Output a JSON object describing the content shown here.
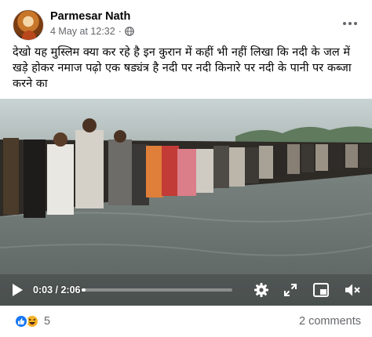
{
  "post": {
    "author": "Parmesar Nath",
    "timestamp": "4 May at 12:32",
    "separator": "·",
    "privacy_icon": "globe-icon",
    "text": "देखो यह मुस्लिम क्या कर रहे है इन कुरान में कहीं भी नहीं लिखा कि नदी के जल में खड़े होकर नमाज पढ़ो एक षड्यंत्र है नदी पर नदी किनारे पर नदी के पानी पर कब्जा करने का"
  },
  "video": {
    "current_time": "0:03",
    "duration": "2:06",
    "progress_fraction": 0.024,
    "controls": [
      "play-icon",
      "settings-icon",
      "fullscreen-icon",
      "picture-in-picture-icon",
      "volume-muted-icon"
    ]
  },
  "footer": {
    "reaction_icons": [
      "like-icon",
      "haha-icon"
    ],
    "reaction_count": "5",
    "comments": "2 comments"
  },
  "colors": {
    "text_primary": "#050505",
    "text_secondary": "#65676b",
    "like_blue": "#1877f2",
    "haha_yellow": "#f7b125"
  }
}
